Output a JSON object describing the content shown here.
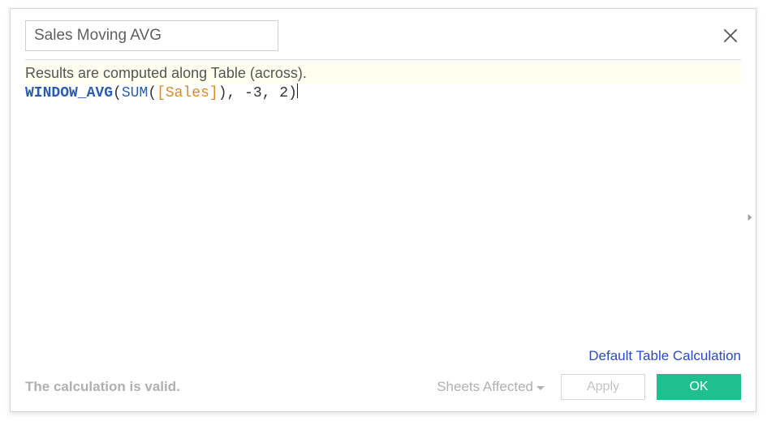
{
  "header": {
    "calc_name": "Sales Moving AVG"
  },
  "info": {
    "message": "Results are computed along Table (across)."
  },
  "formula": {
    "fn": "WINDOW_AVG",
    "open1": "(",
    "agg": "SUM",
    "open2": "(",
    "field": "[Sales]",
    "close2": ")",
    "args_tail": ", -3, 2",
    "close1": ")"
  },
  "footer": {
    "default_link": "Default Table Calculation",
    "status": "The calculation is valid.",
    "sheets_label": "Sheets Affected",
    "apply_label": "Apply",
    "ok_label": "OK"
  }
}
